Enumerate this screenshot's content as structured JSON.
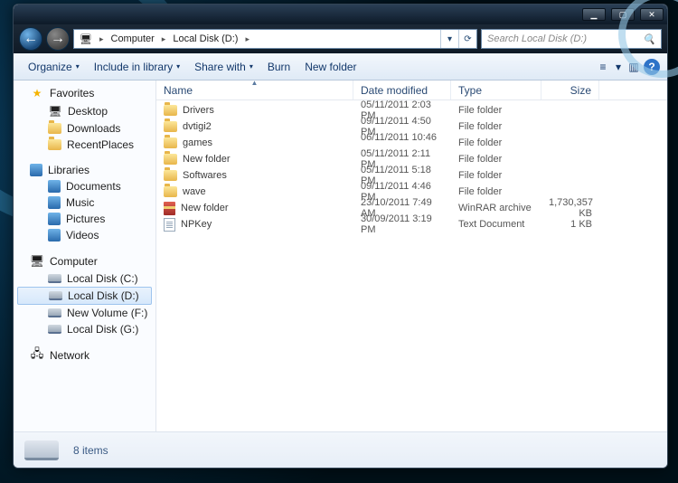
{
  "titlebar": {
    "min": "▁",
    "max": "▢",
    "close": "✕"
  },
  "nav": {
    "back": "←",
    "fwd": "→",
    "pcicon": "🖥",
    "crumbs": [
      "Computer",
      "Local Disk (D:)"
    ],
    "search_placeholder": "Search Local Disk (D:)",
    "search_icon": "🔍",
    "dd": "▾",
    "refresh": "⟳"
  },
  "toolbar": {
    "organize": "Organize",
    "include": "Include in library",
    "share": "Share with",
    "burn": "Burn",
    "newfolder": "New folder",
    "dd": "▾",
    "view": "≡",
    "viewdd": "▾",
    "pane": "▥",
    "help": "?"
  },
  "tree": {
    "fav_hdr": "Favorites",
    "fav": [
      {
        "label": "Desktop",
        "icon": "🖥"
      },
      {
        "label": "Downloads",
        "icon": "folder"
      },
      {
        "label": "RecentPlaces",
        "icon": "folder"
      }
    ],
    "lib_hdr": "Libraries",
    "lib": [
      {
        "label": "Documents"
      },
      {
        "label": "Music"
      },
      {
        "label": "Pictures"
      },
      {
        "label": "Videos"
      }
    ],
    "comp_hdr": "Computer",
    "comp": [
      {
        "label": "Local Disk (C:)",
        "sel": false
      },
      {
        "label": "Local Disk (D:)",
        "sel": true
      },
      {
        "label": "New Volume (F:)",
        "sel": false
      },
      {
        "label": "Local Disk (G:)",
        "sel": false
      }
    ],
    "net_hdr": "Network"
  },
  "columns": {
    "name": "Name",
    "date": "Date modified",
    "type": "Type",
    "size": "Size"
  },
  "rows": [
    {
      "icon": "folder",
      "name": "Drivers",
      "date": "05/11/2011 2:03 PM",
      "type": "File folder",
      "size": ""
    },
    {
      "icon": "folder",
      "name": "dvtigi2",
      "date": "09/11/2011 4:50 PM",
      "type": "File folder",
      "size": ""
    },
    {
      "icon": "folder",
      "name": "games",
      "date": "06/11/2011 10:46 ...",
      "type": "File folder",
      "size": ""
    },
    {
      "icon": "folder",
      "name": "New folder",
      "date": "05/11/2011 2:11 PM",
      "type": "File folder",
      "size": ""
    },
    {
      "icon": "folder",
      "name": "Softwares",
      "date": "05/11/2011 5:18 PM",
      "type": "File folder",
      "size": ""
    },
    {
      "icon": "folder",
      "name": "wave",
      "date": "09/11/2011 4:46 PM",
      "type": "File folder",
      "size": ""
    },
    {
      "icon": "rar",
      "name": "New folder",
      "date": "23/10/2011 7:49 AM",
      "type": "WinRAR archive",
      "size": "1,730,357 KB"
    },
    {
      "icon": "txt",
      "name": "NPKey",
      "date": "30/09/2011 3:19 PM",
      "type": "Text Document",
      "size": "1 KB"
    }
  ],
  "status": {
    "count": "8 items"
  }
}
